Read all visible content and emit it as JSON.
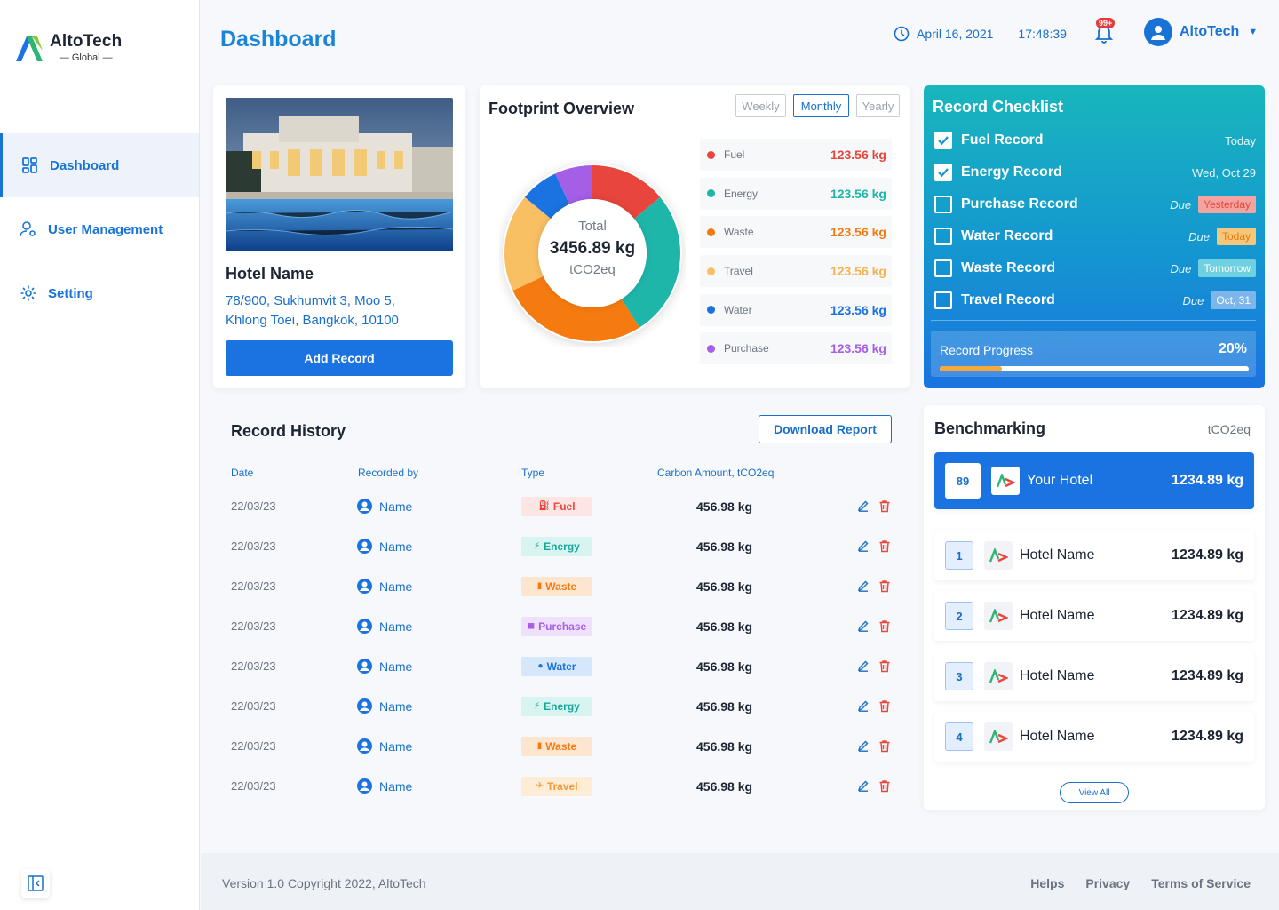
{
  "brand": {
    "name": "AltoTech",
    "sub": "— Global —"
  },
  "nav": [
    {
      "label": "Dashboard"
    },
    {
      "label": "User Management"
    },
    {
      "label": "Setting"
    }
  ],
  "header": {
    "title": "Dashboard",
    "date": "April 16, 2021",
    "time": "17:48:39",
    "notifications": "99+",
    "user": "AltoTech"
  },
  "hotel": {
    "name": "Hotel Name",
    "address_line1": "78/900, Sukhumvit 3, Moo 5,",
    "address_line2": "Khlong Toei, Bangkok, 10100",
    "add_button": "Add Record"
  },
  "footprint": {
    "title": "Footprint Overview",
    "periods": [
      "Weekly",
      "Monthly",
      "Yearly"
    ],
    "selected_period": "Monthly",
    "total_label": "Total",
    "total_value": "3456.89 kg",
    "total_unit": "tCO2eq",
    "items": [
      {
        "name": "Fuel",
        "value": "123.56 kg",
        "color": "#e8453c",
        "share": 0.14
      },
      {
        "name": "Energy",
        "value": "123.56 kg",
        "color": "#1fb6aa",
        "share": 0.27
      },
      {
        "name": "Waste",
        "value": "123.56 kg",
        "color": "#f57b10",
        "share": 0.27
      },
      {
        "name": "Travel",
        "value": "123.56 kg",
        "color": "#f8bf63",
        "share": 0.18
      },
      {
        "name": "Water",
        "value": "123.56 kg",
        "color": "#1a73e0",
        "share": 0.07
      },
      {
        "name": "Purchase",
        "value": "123.56 kg",
        "color": "#a55ee6",
        "share": 0.07
      }
    ]
  },
  "checklist": {
    "title": "Record Checklist",
    "items": [
      {
        "name": "Fuel Record",
        "done": true,
        "due_label": "",
        "when": "Today",
        "pill_color": ""
      },
      {
        "name": "Energy Record",
        "done": true,
        "due_label": "",
        "when": "Wed, Oct 29",
        "pill_color": ""
      },
      {
        "name": "Purchase Record",
        "done": false,
        "due_label": "Due",
        "when": "Yesterday",
        "pill_color": "#f4a4a0"
      },
      {
        "name": "Water Record",
        "done": false,
        "due_label": "Due",
        "when": "Today",
        "pill_color": "#f6c77a"
      },
      {
        "name": "Waste Record",
        "done": false,
        "due_label": "Due",
        "when": "Tomorrow",
        "pill_color": "#6fd0e0"
      },
      {
        "name": "Travel Record",
        "done": false,
        "due_label": "Due",
        "when": "Oct, 31",
        "pill_color": "#7db6ea"
      }
    ],
    "progress_label": "Record Progress",
    "progress_value": "20%",
    "progress_fraction": 0.2
  },
  "history": {
    "title": "Record History",
    "download_label": "Download Report",
    "columns": [
      "Date",
      "Recorded by",
      "Type",
      "Carbon Amount, tCO2eq"
    ],
    "rows": [
      {
        "date": "22/03/23",
        "by": "Name",
        "type": "Fuel",
        "amount": "456.98 kg"
      },
      {
        "date": "22/03/23",
        "by": "Name",
        "type": "Energy",
        "amount": "456.98 kg"
      },
      {
        "date": "22/03/23",
        "by": "Name",
        "type": "Waste",
        "amount": "456.98 kg"
      },
      {
        "date": "22/03/23",
        "by": "Name",
        "type": "Purchase",
        "amount": "456.98 kg"
      },
      {
        "date": "22/03/23",
        "by": "Name",
        "type": "Water",
        "amount": "456.98 kg"
      },
      {
        "date": "22/03/23",
        "by": "Name",
        "type": "Energy",
        "amount": "456.98 kg"
      },
      {
        "date": "22/03/23",
        "by": "Name",
        "type": "Waste",
        "amount": "456.98 kg"
      },
      {
        "date": "22/03/23",
        "by": "Name",
        "type": "Travel",
        "amount": "456.98 kg"
      }
    ],
    "type_colors": {
      "Fuel": {
        "fg": "#e8453c",
        "bg": "#fde5e3",
        "icon": "fuel-icon",
        "glyph": "⛽"
      },
      "Energy": {
        "fg": "#17a89c",
        "bg": "#d8f4f1",
        "icon": "bolt-icon",
        "glyph": "⚡"
      },
      "Waste": {
        "fg": "#f57b10",
        "bg": "#fde6d0",
        "icon": "bin-icon",
        "glyph": "▮"
      },
      "Purchase": {
        "fg": "#a55ee6",
        "bg": "#efe1fb",
        "icon": "bag-icon",
        "glyph": "◼"
      },
      "Water": {
        "fg": "#1a73e0",
        "bg": "#d6e7fb",
        "icon": "drop-icon",
        "glyph": "●"
      },
      "Travel": {
        "fg": "#f59a3a",
        "bg": "#fdecd6",
        "icon": "plane-icon",
        "glyph": "✈"
      }
    }
  },
  "benchmark": {
    "title": "Benchmarking",
    "unit": "tCO2eq",
    "rows": [
      {
        "rank": "89",
        "name": "Your Hotel",
        "value": "1234.89 kg",
        "self": true
      },
      {
        "rank": "1",
        "name": "Hotel Name",
        "value": "1234.89 kg",
        "self": false
      },
      {
        "rank": "2",
        "name": "Hotel Name",
        "value": "1234.89 kg",
        "self": false
      },
      {
        "rank": "3",
        "name": "Hotel Name",
        "value": "1234.89 kg",
        "self": false
      },
      {
        "rank": "4",
        "name": "Hotel Name",
        "value": "1234.89 kg",
        "self": false
      }
    ],
    "view_all": "View All"
  },
  "footer": {
    "copyright": "Version 1.0 Copyright 2022, AltoTech",
    "links": [
      "Helps",
      "Privacy",
      "Terms of Service"
    ]
  }
}
